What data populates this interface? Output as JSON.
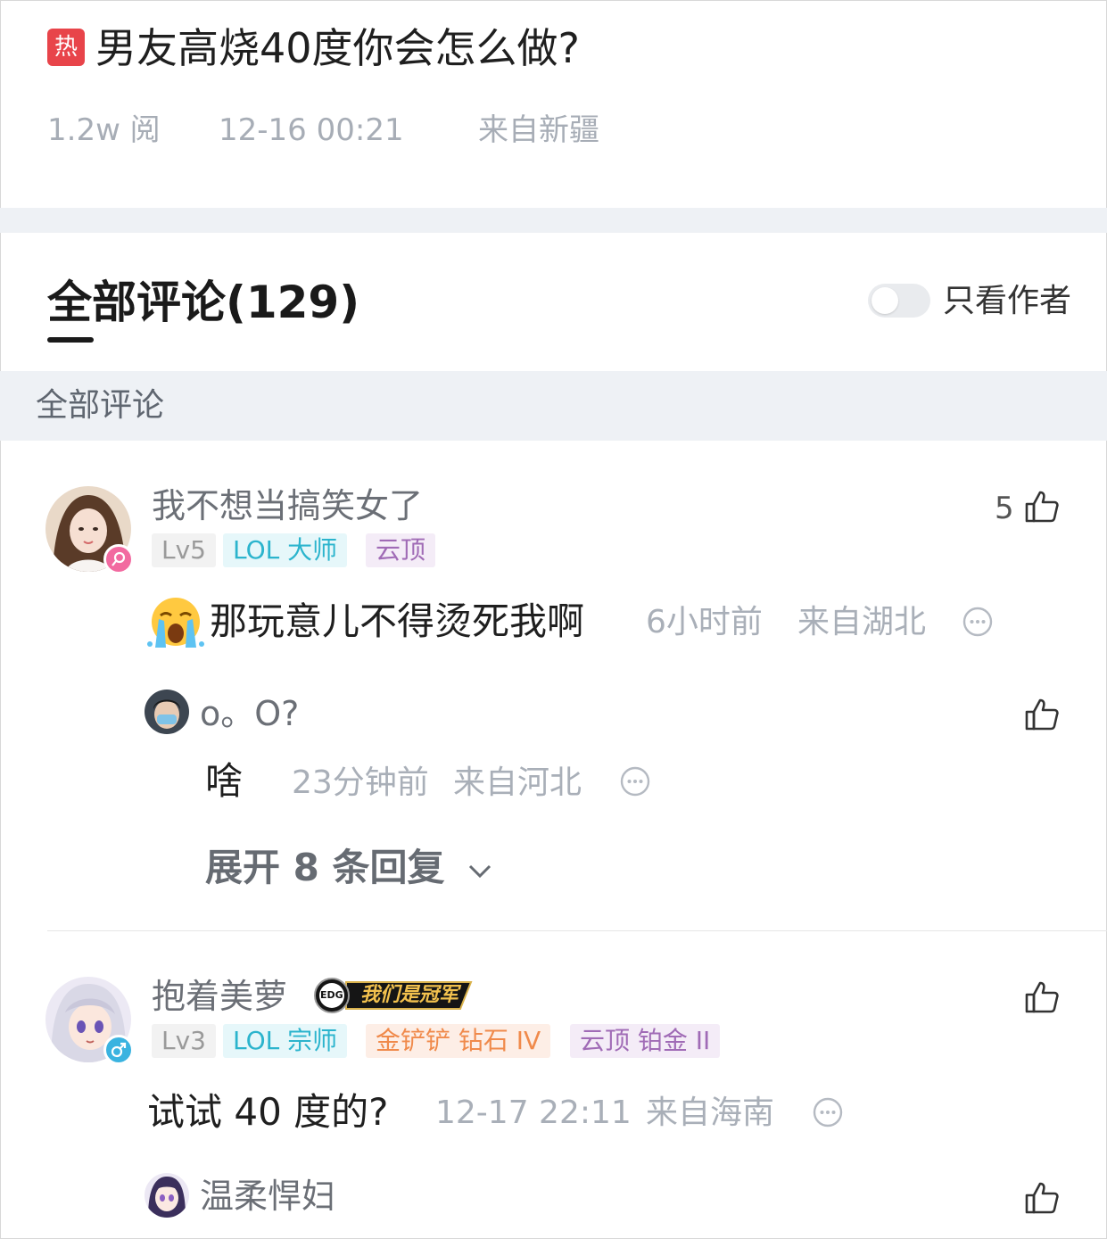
{
  "post": {
    "badge": "热",
    "title": "男友高烧40度你会怎么做?",
    "views": "1.2w 阅",
    "time": "12-16  00:21",
    "location": "来自新疆"
  },
  "comments_header": {
    "title": "全部评论(129)",
    "author_only_label": "只看作者",
    "author_only_on": false,
    "subbar_label": "全部评论"
  },
  "colors": {
    "hot": "#e8444a",
    "cyan_tag": "#2bb4cd",
    "purple_tag": "#a06bb6",
    "orange_tag": "#f08a4b"
  },
  "comments": [
    {
      "user": "我不想当搞笑女了",
      "gender": "female",
      "tags": [
        "Lv5",
        "LOL 大师",
        "云顶"
      ],
      "emoji": "crying-emoji",
      "text": "那玩意儿不得烫死我啊",
      "time": "6小时前",
      "location": "来自湖北",
      "likes": "5",
      "reply": {
        "user": "o。O?",
        "text": "啥",
        "time": "23分钟前",
        "location": "来自河北"
      },
      "expand_label": "展开 8 条回复"
    },
    {
      "user": "抱着美萝",
      "gender": "male",
      "badge_text": "我们是冠军",
      "badge_logo": "EDG",
      "tags": [
        "Lv3",
        "LOL 宗师",
        "金铲铲 钻石 IV",
        "云顶 铂金 II"
      ],
      "text": "试试 40 度的?",
      "time": "12-17  22:11",
      "location": "来自海南",
      "reply": {
        "user": "温柔悍妇"
      }
    }
  ]
}
